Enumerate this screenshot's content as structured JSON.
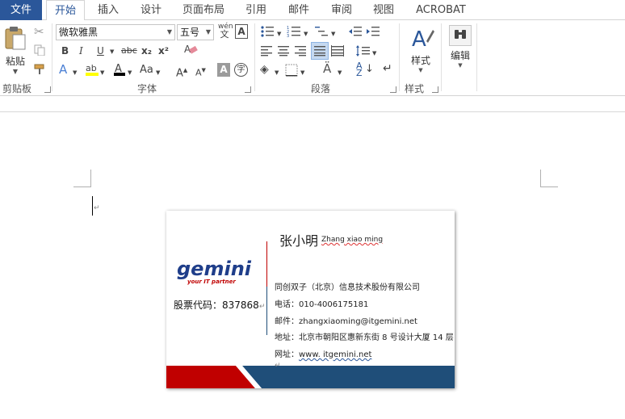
{
  "tabs": [
    "文件",
    "开始",
    "插入",
    "设计",
    "页面布局",
    "引用",
    "邮件",
    "审阅",
    "视图",
    "ACROBAT"
  ],
  "ribbon": {
    "clipboard": {
      "paste_label": "粘贴",
      "group_label": "剪贴板"
    },
    "font": {
      "font_name": "微软雅黑",
      "font_size": "五号",
      "group_label": "字体",
      "bold": "B",
      "italic": "I",
      "underline": "U",
      "strike": "abc",
      "subscript": "x₂",
      "superscript": "x²",
      "grow": "A",
      "shrink": "A",
      "case": "Aa",
      "wen": "wén",
      "wen2": "文"
    },
    "paragraph": {
      "group_label": "段落"
    },
    "styles": {
      "label": "样式",
      "group_label": "样式"
    },
    "editing": {
      "label": "编辑"
    }
  },
  "card": {
    "logo_text": "gemini",
    "logo_tagline": "your IT partner",
    "stock": "股票代码：837868",
    "name": "张小明",
    "pinyin": "Zhang xiao ming",
    "company": "同创双子（北京）信息技术股份有限公司",
    "phone": "电话：010-4006175181",
    "email": "邮件：zhangxiaoming@itgemini.net",
    "address": "地址：北京市朝阳区惠新东街 8 号设计大厦 14 层",
    "website_label": "网址：",
    "website": "www. itgemini.net"
  },
  "colors": {
    "file_tab": "#2b579a",
    "card_red": "#c00000",
    "card_blue": "#1f4e79"
  }
}
